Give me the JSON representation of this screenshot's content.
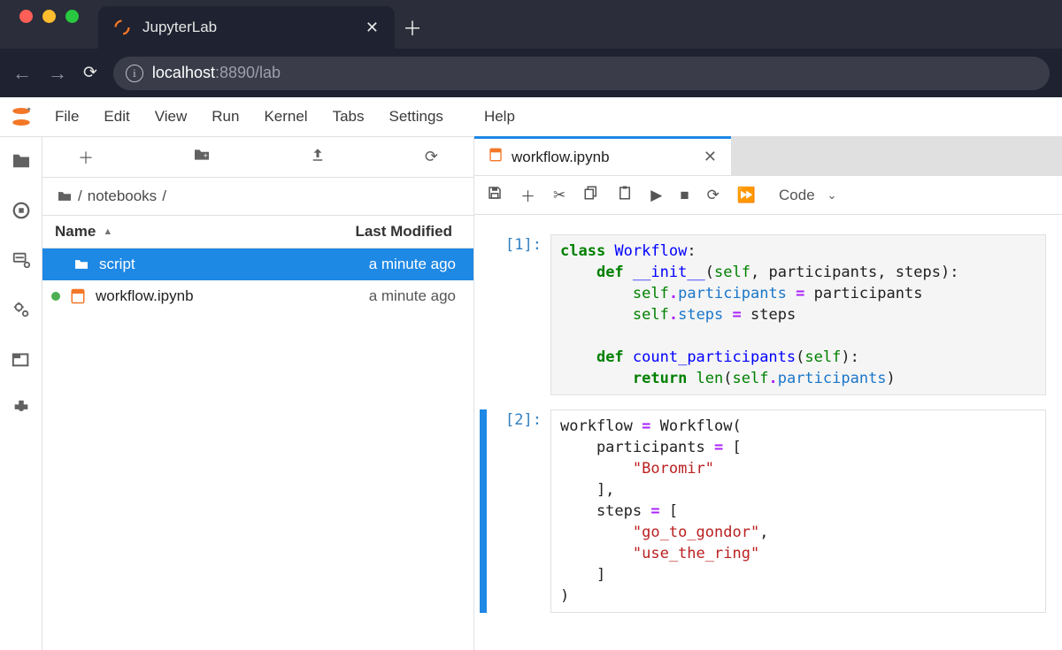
{
  "browser": {
    "tab_title": "JupyterLab",
    "url_host": "localhost",
    "url_port_path": ":8890/lab"
  },
  "menu": {
    "items": [
      "File",
      "Edit",
      "View",
      "Run",
      "Kernel",
      "Tabs",
      "Settings",
      "Help"
    ]
  },
  "filebrowser": {
    "breadcrumb_label": "notebooks",
    "col_name": "Name",
    "col_modified": "Last Modified",
    "items": [
      {
        "type": "dir",
        "name": "script",
        "modified": "a minute ago",
        "selected": true,
        "running": false
      },
      {
        "type": "nb",
        "name": "workflow.ipynb",
        "modified": "a minute ago",
        "selected": false,
        "running": true
      }
    ]
  },
  "notebook": {
    "tab_name": "workflow.ipynb",
    "cell_type": "Code",
    "cells": [
      {
        "prompt": "[1]:",
        "active": false,
        "tokens": [
          {
            "t": "class ",
            "c": "kw"
          },
          {
            "t": "Workflow",
            "c": "def"
          },
          {
            "t": ":",
            "c": "paren"
          },
          {
            "t": "\n"
          },
          {
            "t": "    "
          },
          {
            "t": "def ",
            "c": "kw"
          },
          {
            "t": "__init__",
            "c": "fn"
          },
          {
            "t": "(",
            "c": "paren"
          },
          {
            "t": "self",
            "c": "self"
          },
          {
            "t": ", participants, steps",
            "c": "paren"
          },
          {
            "t": ")",
            "c": "paren"
          },
          {
            "t": ":",
            "c": "paren"
          },
          {
            "t": "\n"
          },
          {
            "t": "        "
          },
          {
            "t": "self",
            "c": "self"
          },
          {
            "t": ".",
            "c": "op"
          },
          {
            "t": "participants",
            "c": "attr"
          },
          {
            "t": " "
          },
          {
            "t": "=",
            "c": "op"
          },
          {
            "t": " participants",
            "c": "paren"
          },
          {
            "t": "\n"
          },
          {
            "t": "        "
          },
          {
            "t": "self",
            "c": "self"
          },
          {
            "t": ".",
            "c": "op"
          },
          {
            "t": "steps",
            "c": "attr"
          },
          {
            "t": " "
          },
          {
            "t": "=",
            "c": "op"
          },
          {
            "t": " steps",
            "c": "paren"
          },
          {
            "t": "\n"
          },
          {
            "t": "\n"
          },
          {
            "t": "    "
          },
          {
            "t": "def ",
            "c": "kw"
          },
          {
            "t": "count_participants",
            "c": "fn"
          },
          {
            "t": "(",
            "c": "paren"
          },
          {
            "t": "self",
            "c": "self"
          },
          {
            "t": ")",
            "c": "paren"
          },
          {
            "t": ":",
            "c": "paren"
          },
          {
            "t": "\n"
          },
          {
            "t": "        "
          },
          {
            "t": "return ",
            "c": "kw"
          },
          {
            "t": "len",
            "c": "builtin"
          },
          {
            "t": "(",
            "c": "paren"
          },
          {
            "t": "self",
            "c": "self"
          },
          {
            "t": ".",
            "c": "op"
          },
          {
            "t": "participants",
            "c": "attr"
          },
          {
            "t": ")",
            "c": "paren"
          }
        ]
      },
      {
        "prompt": "[2]:",
        "active": true,
        "tokens": [
          {
            "t": "workflow ",
            "c": "paren"
          },
          {
            "t": "=",
            "c": "op"
          },
          {
            "t": " Workflow(",
            "c": "paren"
          },
          {
            "t": "\n"
          },
          {
            "t": "    participants ",
            "c": "paren"
          },
          {
            "t": "=",
            "c": "op"
          },
          {
            "t": " [",
            "c": "paren"
          },
          {
            "t": "\n"
          },
          {
            "t": "        "
          },
          {
            "t": "\"Boromir\"",
            "c": "str"
          },
          {
            "t": "\n"
          },
          {
            "t": "    ],",
            "c": "paren"
          },
          {
            "t": "\n"
          },
          {
            "t": "    steps ",
            "c": "paren"
          },
          {
            "t": "=",
            "c": "op"
          },
          {
            "t": " [",
            "c": "paren"
          },
          {
            "t": "\n"
          },
          {
            "t": "        "
          },
          {
            "t": "\"go_to_gondor\"",
            "c": "str"
          },
          {
            "t": ",",
            "c": "paren"
          },
          {
            "t": "\n"
          },
          {
            "t": "        "
          },
          {
            "t": "\"use_the_ring\"",
            "c": "str"
          },
          {
            "t": "\n"
          },
          {
            "t": "    ]",
            "c": "paren"
          },
          {
            "t": "\n"
          },
          {
            "t": ")",
            "c": "paren"
          }
        ]
      }
    ]
  }
}
